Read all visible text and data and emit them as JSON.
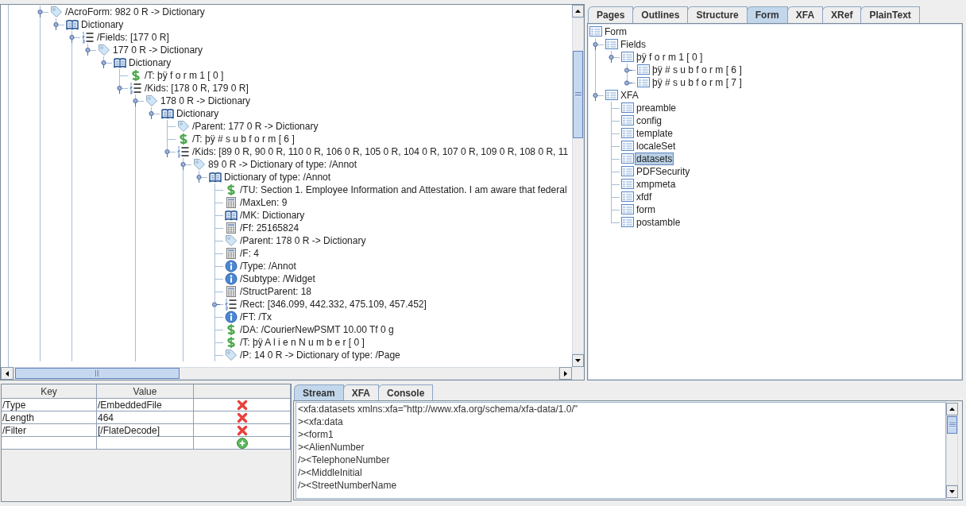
{
  "object_tree": {
    "more_nodes": true,
    "nodes": [
      {
        "kind": "reference",
        "label": "/AcroForm: 982 0 R -> Dictionary",
        "selected": false,
        "expanded": true,
        "more_children": false,
        "children": [
          {
            "kind": "dictionary",
            "label": "Dictionary",
            "selected": false,
            "expanded": true,
            "more_children": true,
            "children": [
              {
                "kind": "array",
                "label": "/Fields: [177 0 R]",
                "selected": false,
                "expanded": true,
                "more_children": false,
                "children": [
                  {
                    "kind": "reference",
                    "label": "177 0 R -> Dictionary",
                    "selected": false,
                    "expanded": true,
                    "more_children": false,
                    "children": [
                      {
                        "kind": "dictionary",
                        "label": "Dictionary",
                        "selected": false,
                        "expanded": true,
                        "more_children": false,
                        "children": [
                          {
                            "kind": "string",
                            "label": "/T: þÿ f o r m 1 [ 0 ]",
                            "selected": false
                          },
                          {
                            "kind": "array",
                            "label": "/Kids: [178 0 R, 179 0 R]",
                            "selected": false,
                            "expanded": true,
                            "more_children": true,
                            "children": [
                              {
                                "kind": "reference",
                                "label": "178 0 R -> Dictionary",
                                "selected": false,
                                "expanded": true,
                                "more_children": false,
                                "children": [
                                  {
                                    "kind": "dictionary",
                                    "label": "Dictionary",
                                    "selected": false,
                                    "expanded": true,
                                    "more_children": false,
                                    "children": [
                                      {
                                        "kind": "reference",
                                        "label": "/Parent: 177 0 R -> Dictionary",
                                        "selected": false
                                      },
                                      {
                                        "kind": "string",
                                        "label": "/T: þÿ # s u b f o r m [ 6 ]",
                                        "selected": false
                                      },
                                      {
                                        "kind": "array",
                                        "label": "/Kids: [89 0 R, 90 0 R, 110 0 R, 106 0 R, 105 0 R, 104 0 R, 107 0 R, 109 0 R, 108 0 R, 11",
                                        "selected": false,
                                        "expanded": true,
                                        "more_children": true,
                                        "children": [
                                          {
                                            "kind": "reference",
                                            "label": "89 0 R -> Dictionary of type: /Annot",
                                            "selected": false,
                                            "expanded": true,
                                            "more_children": false,
                                            "children": [
                                              {
                                                "kind": "dictionary",
                                                "label": "Dictionary of type: /Annot",
                                                "selected": false,
                                                "expanded": true,
                                                "more_children": true,
                                                "children": [
                                                  {
                                                    "kind": "string",
                                                    "label": "/TU: Section 1. Employee Information and Attestation. I am aware that federal",
                                                    "selected": false
                                                  },
                                                  {
                                                    "kind": "number",
                                                    "label": "/MaxLen: 9",
                                                    "selected": false
                                                  },
                                                  {
                                                    "kind": "dictionary",
                                                    "label": "/MK: Dictionary",
                                                    "selected": false
                                                  },
                                                  {
                                                    "kind": "number",
                                                    "label": "/Ff: 25165824",
                                                    "selected": false
                                                  },
                                                  {
                                                    "kind": "reference",
                                                    "label": "/Parent: 178 0 R -> Dictionary",
                                                    "selected": false
                                                  },
                                                  {
                                                    "kind": "number",
                                                    "label": "/F: 4",
                                                    "selected": false
                                                  },
                                                  {
                                                    "kind": "name",
                                                    "label": "/Type: /Annot",
                                                    "selected": false
                                                  },
                                                  {
                                                    "kind": "name",
                                                    "label": "/Subtype: /Widget",
                                                    "selected": false
                                                  },
                                                  {
                                                    "kind": "number",
                                                    "label": "/StructParent: 18",
                                                    "selected": false
                                                  },
                                                  {
                                                    "kind": "array",
                                                    "label": "/Rect: [346.099, 442.332, 475.109, 457.452]",
                                                    "selected": false,
                                                    "expanded": false
                                                  },
                                                  {
                                                    "kind": "name",
                                                    "label": "/FT: /Tx",
                                                    "selected": false
                                                  },
                                                  {
                                                    "kind": "string",
                                                    "label": "/DA: /CourierNewPSMT 10.00 Tf 0 g",
                                                    "selected": false
                                                  },
                                                  {
                                                    "kind": "string",
                                                    "label": "/T: þÿ A l i e n N u m b e r [ 0 ]",
                                                    "selected": false
                                                  },
                                                  {
                                                    "kind": "reference",
                                                    "label": "/P: 14 0 R -> Dictionary of type: /Page",
                                                    "selected": false
                                                  }
                                                ]
                                              }
                                            ]
                                          }
                                        ]
                                      }
                                    ]
                                  }
                                ]
                              }
                            ]
                          }
                        ]
                      }
                    ]
                  }
                ]
              }
            ]
          }
        ]
      }
    ]
  },
  "inspector": {
    "tabs": [
      {
        "label": "Pages",
        "selected": false
      },
      {
        "label": "Outlines",
        "selected": false
      },
      {
        "label": "Structure",
        "selected": false
      },
      {
        "label": "Form",
        "selected": true
      },
      {
        "label": "XFA",
        "selected": false
      },
      {
        "label": "XRef",
        "selected": false
      },
      {
        "label": "PlainText",
        "selected": false
      }
    ],
    "form_tree": {
      "nodes": [
        {
          "label": "Form",
          "selected": false,
          "children": [
            {
              "label": "Fields",
              "selected": false,
              "expanded": true,
              "children": [
                {
                  "label": "þÿ f o r m 1 [ 0 ]",
                  "selected": false,
                  "expanded": true,
                  "children": [
                    {
                      "label": "þÿ # s u b f o r m [ 6 ]",
                      "selected": false,
                      "expanded": false
                    },
                    {
                      "label": "þÿ # s u b f o r m [ 7 ]",
                      "selected": false,
                      "expanded": false
                    }
                  ]
                }
              ]
            },
            {
              "label": "XFA",
              "selected": false,
              "expanded": true,
              "children": [
                {
                  "label": "preamble",
                  "selected": false
                },
                {
                  "label": "config",
                  "selected": false
                },
                {
                  "label": "template",
                  "selected": false
                },
                {
                  "label": "localeSet",
                  "selected": false
                },
                {
                  "label": "datasets",
                  "selected": true
                },
                {
                  "label": "PDFSecurity",
                  "selected": false
                },
                {
                  "label": "xmpmeta",
                  "selected": false
                },
                {
                  "label": "xfdf",
                  "selected": false
                },
                {
                  "label": "form",
                  "selected": false
                },
                {
                  "label": "postamble",
                  "selected": false
                }
              ]
            }
          ]
        }
      ]
    }
  },
  "dictionary_table": {
    "columns": [
      "Key",
      "Value"
    ],
    "rows": [
      {
        "kind": "entry",
        "key": "/Type",
        "value": "/EmbeddedFile"
      },
      {
        "kind": "entry",
        "key": "/Length",
        "value": "464"
      },
      {
        "kind": "entry",
        "key": "/Filter",
        "value": "[/FlateDecode]"
      },
      {
        "kind": "add"
      }
    ]
  },
  "stream_panel": {
    "tabs": [
      {
        "label": "Stream",
        "selected": true
      },
      {
        "label": "XFA",
        "selected": false
      },
      {
        "label": "Console",
        "selected": false
      }
    ],
    "lines": [
      "<xfa:datasets xmlns:xfa=\"http://www.xfa.org/schema/xfa-data/1.0/\"",
      "><xfa:data",
      "><form1",
      "><AlienNumber",
      "/><TelephoneNumber",
      "/><MiddleInitial",
      "/><StreetNumberName"
    ]
  }
}
